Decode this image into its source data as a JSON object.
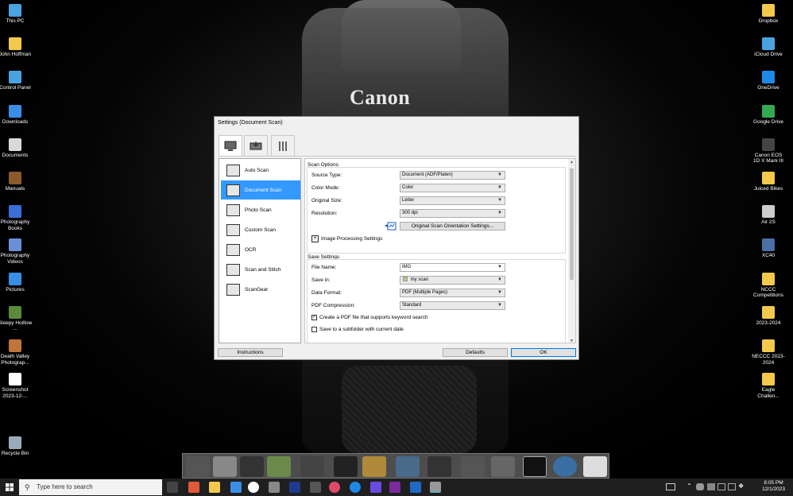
{
  "desktop": {
    "left_icons": [
      {
        "label": "This PC",
        "color": "#4aa3df"
      },
      {
        "label": "John Hoffman",
        "color": "#f2c94c"
      },
      {
        "label": "Control Panel",
        "color": "#4aa3df"
      },
      {
        "label": "Downloads",
        "color": "#3a8ee6"
      },
      {
        "label": "Documents",
        "color": "#d9d9d9"
      },
      {
        "label": "Manuals",
        "color": "#8a5a2b"
      },
      {
        "label": "Photography Books",
        "color": "#3a6fd8"
      },
      {
        "label": "Photography Videos",
        "color": "#6a8fd8"
      },
      {
        "label": "Pictures",
        "color": "#3a8ee6"
      },
      {
        "label": "Sleepy Hoillow ...",
        "color": "#5a8a3a"
      },
      {
        "label": "Death Valley Photograp...",
        "color": "#c0743a"
      },
      {
        "label": "Screenshot 2023-12-...",
        "color": "#ffffff"
      },
      {
        "label": "Recycle Bin",
        "color": "#9ab"
      }
    ],
    "right_icons": [
      {
        "label": "Dropbox",
        "color": "#f2c94c"
      },
      {
        "label": "iCloud Drive",
        "color": "#4aa3df"
      },
      {
        "label": "OneDrive",
        "color": "#1e88e5"
      },
      {
        "label": "Google Drive",
        "color": "#34a853"
      },
      {
        "label": "Canon EOS 1D X Mark III",
        "color": "#444"
      },
      {
        "label": "Juiced Bikes",
        "color": "#f2c94c"
      },
      {
        "label": "Air 2S",
        "color": "#ccc"
      },
      {
        "label": "XC40",
        "color": "#4a6fa5"
      },
      {
        "label": "NCCC Competitions",
        "color": "#f2c94c"
      },
      {
        "label": "2023-2024",
        "color": "#f2c94c"
      },
      {
        "label": "NECCC 2023-2024",
        "color": "#f2c94c"
      },
      {
        "label": "Eagle Challen...",
        "color": "#f2c94c"
      }
    ],
    "wallpaper_brand": "Canon"
  },
  "dialog": {
    "title": "Settings (Document Scan)",
    "tabs": [
      {
        "name": "scan-from-computer-tab",
        "icon": "computer-scan-icon"
      },
      {
        "name": "scan-from-panel-tab",
        "icon": "panel-scan-icon"
      },
      {
        "name": "general-settings-tab",
        "icon": "tools-icon"
      }
    ],
    "nav_items": [
      {
        "label": "Auto Scan",
        "selected": false
      },
      {
        "label": "Document Scan",
        "selected": true
      },
      {
        "label": "Photo Scan",
        "selected": false
      },
      {
        "label": "Custom Scan",
        "selected": false
      },
      {
        "label": "OCR",
        "selected": false
      },
      {
        "label": "Scan and Stitch",
        "selected": false
      },
      {
        "label": "ScanGear",
        "selected": false
      }
    ],
    "scan_options": {
      "title": "Scan Options",
      "source_type_label": "Source Type:",
      "source_type_value": "Document (ADF/Platen)",
      "color_mode_label": "Color Mode:",
      "color_mode_value": "Color",
      "original_size_label": "Original Size:",
      "original_size_value": "Letter",
      "resolution_label": "Resolution:",
      "resolution_value": "300 dpi",
      "orientation_button": "Original Scan Orientation Settings...",
      "image_processing_label": "Image Processing Settings",
      "expand_symbol": "+"
    },
    "save_settings": {
      "title": "Save Settings",
      "file_name_label": "File Name:",
      "file_name_value": "IMG",
      "save_in_label": "Save in:",
      "save_in_value": "my scan",
      "data_format_label": "Data Format:",
      "data_format_value": "PDF (Multiple Pages)",
      "pdf_compression_label": "PDF Compression:",
      "pdf_compression_value": "Standard",
      "keyword_search_label": "Create a PDF file that supports keyword search",
      "keyword_search_checked": true,
      "subfolder_label": "Save to a subfolder with current date",
      "subfolder_checked": false
    },
    "buttons": {
      "instructions": "Instructions",
      "defaults": "Defaults",
      "ok": "OK"
    }
  },
  "taskbar": {
    "search_placeholder": "Type here to search",
    "time": "8:05 PM",
    "date": "12/1/2023"
  },
  "colors": {
    "selection": "#3399ff",
    "accent": "#0078d7"
  }
}
